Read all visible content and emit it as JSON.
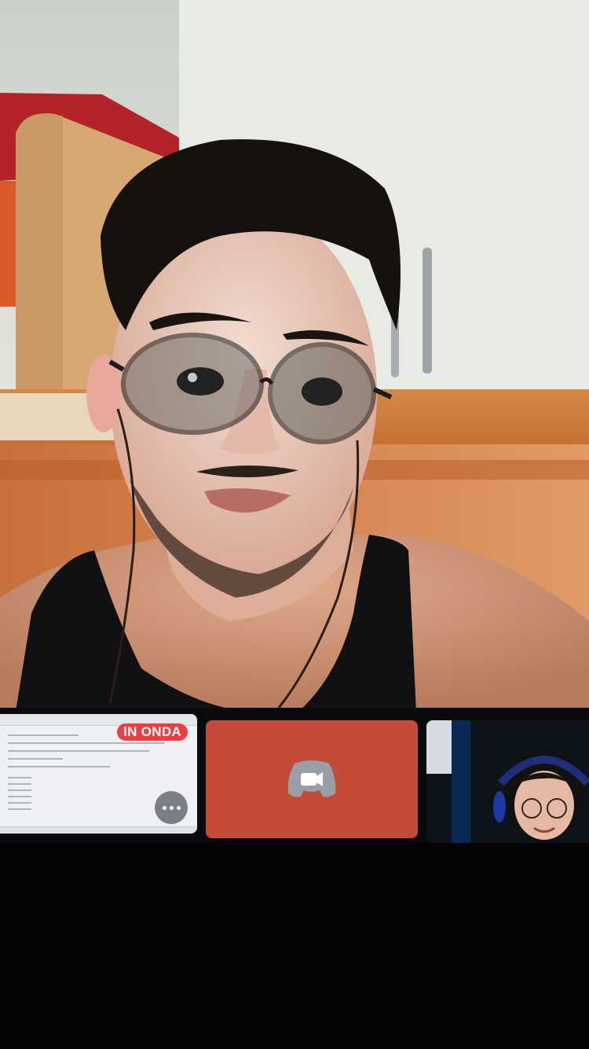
{
  "app": {
    "name": "Discord",
    "accent_color": "#c44a3a"
  },
  "main_feed": {
    "type": "participant-video"
  },
  "thumbnails": {
    "screen_share": {
      "live_badge": "IN ONDA",
      "live_badge_color": "#ea3f42",
      "more_icon": "ellipsis-icon"
    },
    "camera_off_participant": {
      "background_color": "#c44a3a",
      "icon": "discord-video-icon"
    },
    "participant_video": {
      "type": "participant-video"
    }
  }
}
